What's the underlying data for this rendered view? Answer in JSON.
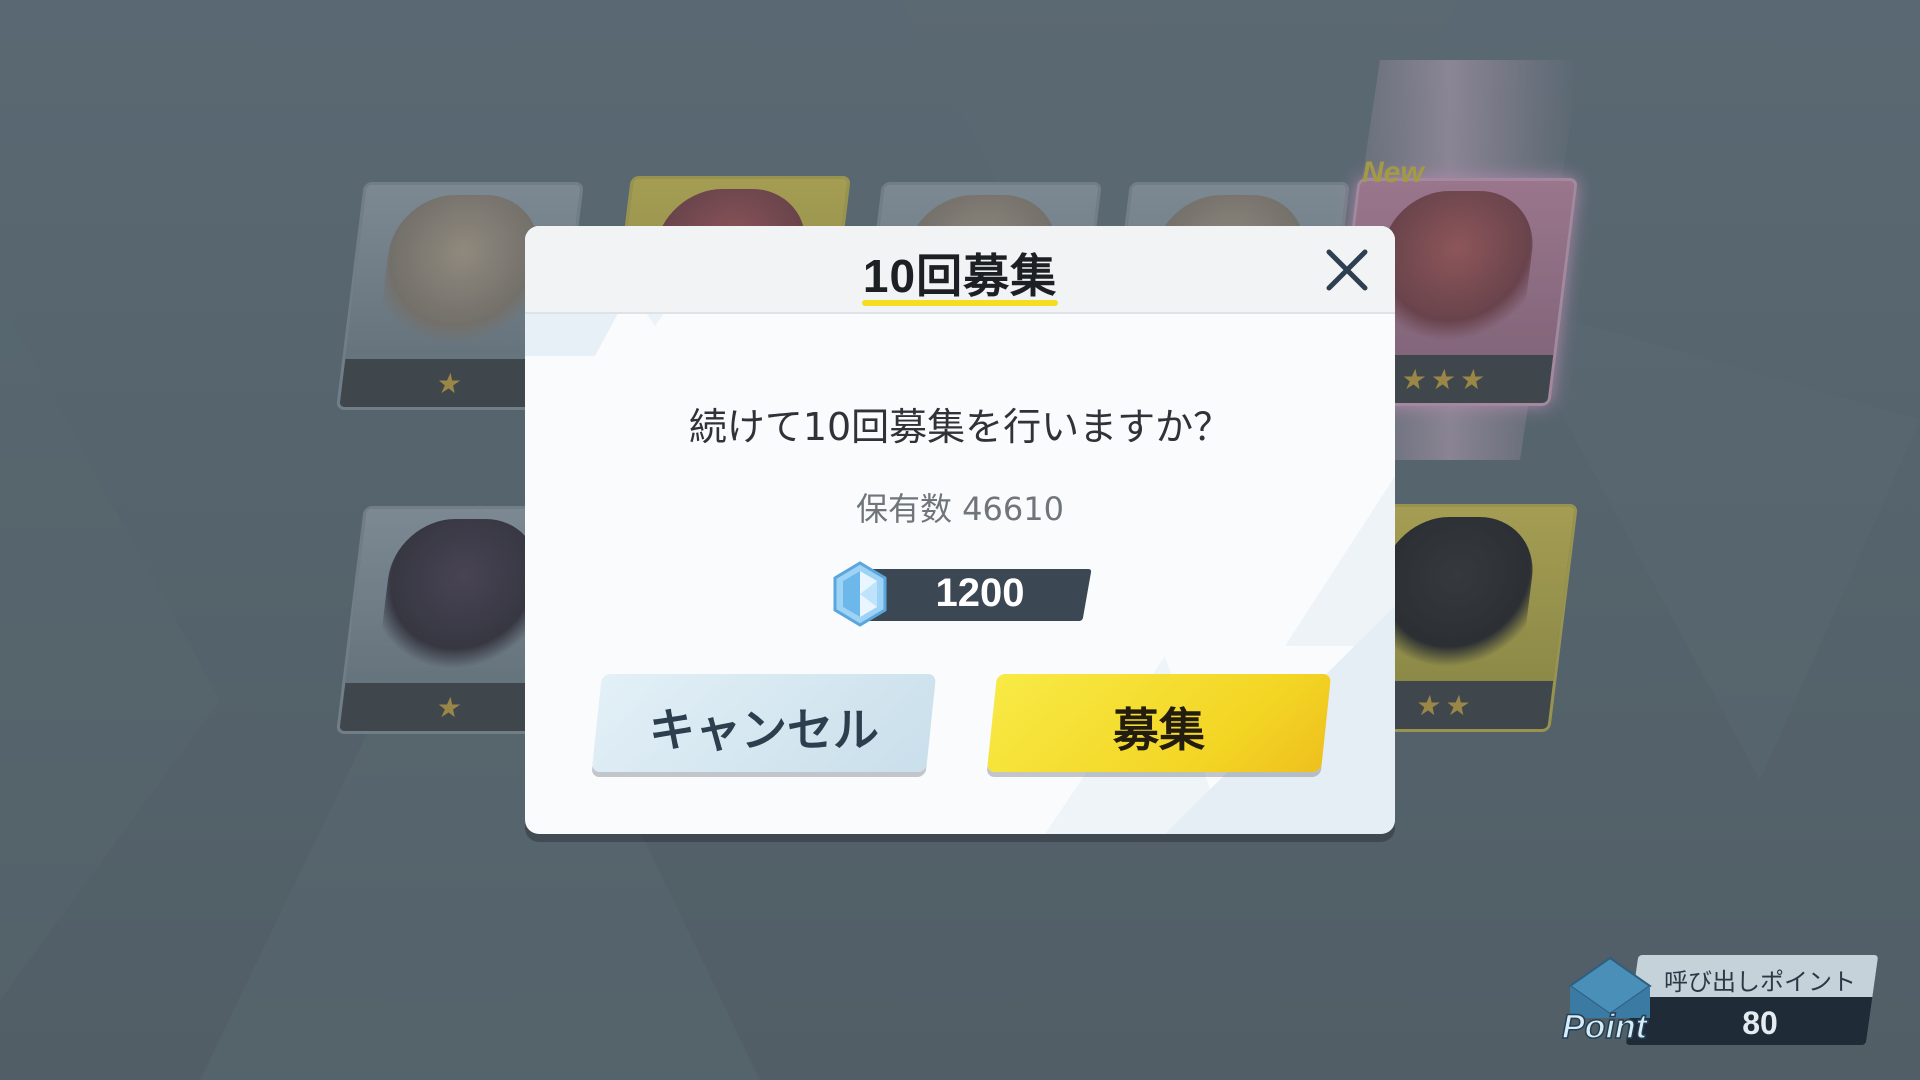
{
  "background_cards": [
    {
      "stars": 1,
      "badge": ""
    },
    {
      "stars": 0,
      "badge": ""
    },
    {
      "stars": 0,
      "badge": ""
    },
    {
      "stars": 0,
      "badge": ""
    },
    {
      "stars": 3,
      "badge": "New"
    },
    {
      "stars": 1,
      "badge": ""
    },
    {
      "stars": 2,
      "badge": ""
    }
  ],
  "dialog": {
    "title": "10回募集",
    "question": "続けて10回募集を行いますか？",
    "owned": "保有数 46610",
    "cost": "1200",
    "cancel_label": "キャンセル",
    "confirm_label": "募集",
    "close_icon": "close-icon",
    "gem_icon": "crystal-gem-icon"
  },
  "point_widget": {
    "label": "呼び出しポイント",
    "value": "80",
    "icon_text": "Point"
  },
  "colors": {
    "accent_yellow": "#f5dd22",
    "dialog_bg": "#fafbfc",
    "cost_bar": "#3b4753"
  }
}
